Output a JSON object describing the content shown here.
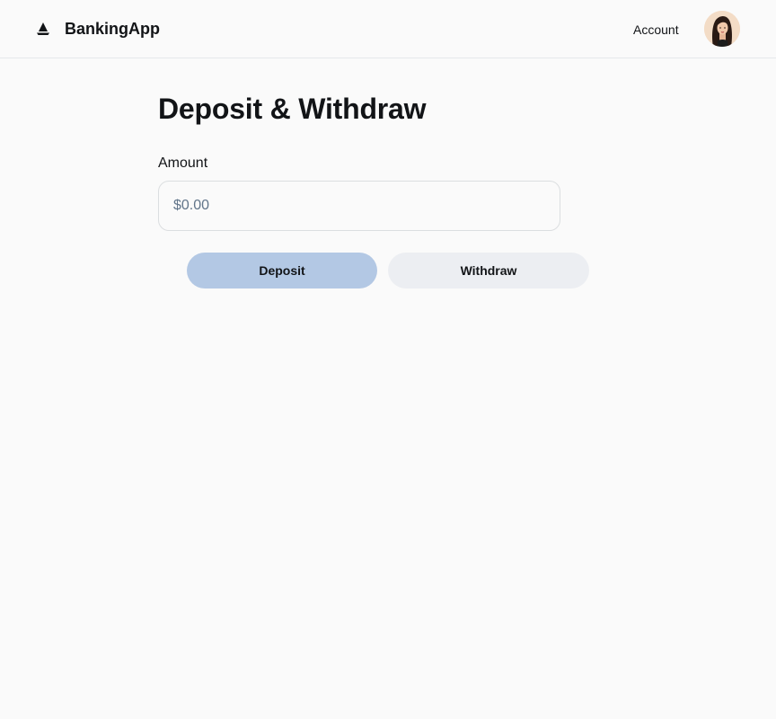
{
  "header": {
    "app_name": "BankingApp",
    "logo_icon": "sailboat-logo-icon",
    "nav": {
      "account_label": "Account"
    },
    "avatar": "user-avatar"
  },
  "main": {
    "title": "Deposit & Withdraw",
    "amount": {
      "label": "Amount",
      "value": "",
      "placeholder": "$0.00"
    },
    "actions": {
      "deposit_label": "Deposit",
      "withdraw_label": "Withdraw"
    }
  },
  "colors": {
    "background": "#fafafa",
    "deposit_button": "#b3c8e4",
    "withdraw_button": "#eceef2",
    "text": "#121417",
    "placeholder": "#61758a"
  }
}
